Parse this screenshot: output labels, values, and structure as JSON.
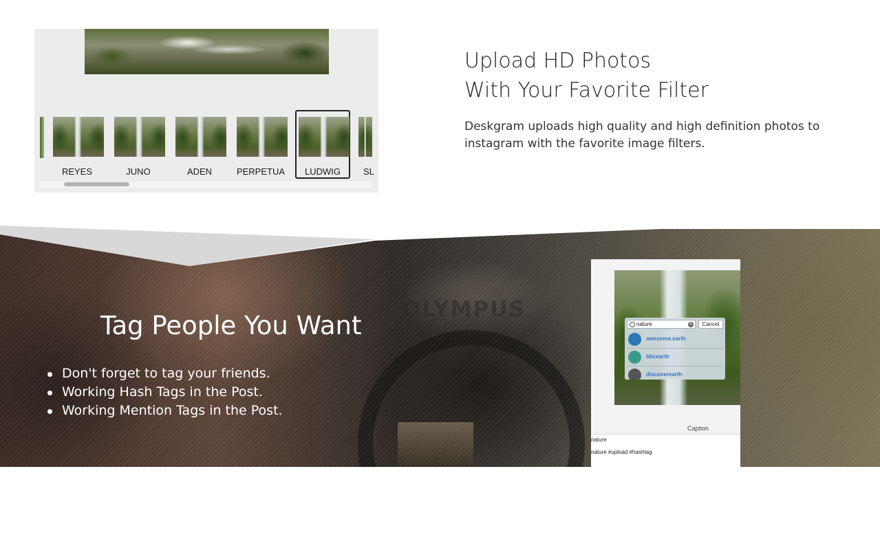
{
  "upload_section": {
    "headline_line1": "Upload HD Photos",
    "headline_line2": "With Your Favorite Filter",
    "description_line1": "Deskgram uploads high quality and high definition photos to",
    "description_line2": "instagram with the favorite image filters.",
    "filters": [
      {
        "label": "REYES",
        "selected": false
      },
      {
        "label": "JUNO",
        "selected": false
      },
      {
        "label": "ADEN",
        "selected": false
      },
      {
        "label": "PERPETUA",
        "selected": false
      },
      {
        "label": "LUDWIG",
        "selected": true
      },
      {
        "label": "SL",
        "selected": false
      }
    ]
  },
  "tag_section": {
    "headline": "Tag People You Want",
    "bullets": [
      "Don't forget to tag your friends.",
      "Working Hash Tags in the Post.",
      "Working Mention Tags in the Post."
    ],
    "background_text": "OLYMPUS"
  },
  "tag_screenshot": {
    "search_value": "nature",
    "cancel_label": "Cancel",
    "results": [
      {
        "name": "awesome.earth",
        "avatar_color": "#2b77b5"
      },
      {
        "name": "bbcearth",
        "avatar_color": "#3a9a8a"
      },
      {
        "name": "discoverearth",
        "avatar_color": "#555555"
      }
    ],
    "caption_label": "Caption",
    "caption_line1": "nature",
    "caption_line2": "nature #upload #hashtag"
  },
  "colors": {
    "heading_dark": "#222222",
    "link_blue": "#3575c4",
    "light_panel": "#ececec"
  }
}
